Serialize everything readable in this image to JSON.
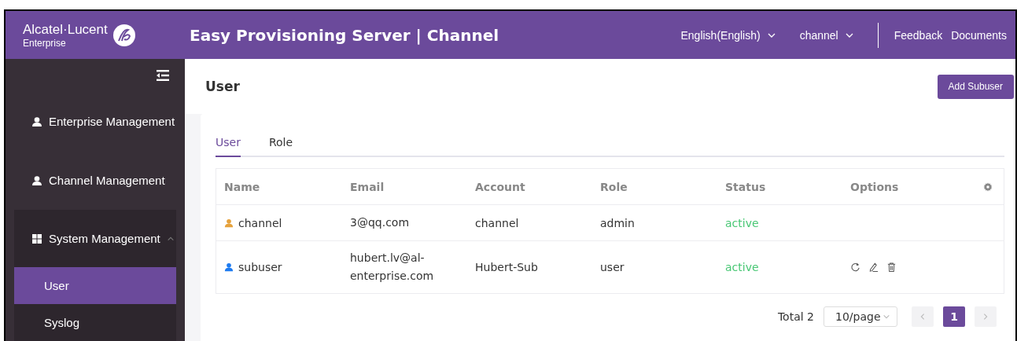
{
  "header": {
    "brand": "Alcatel·Lucent",
    "brand_sub": "Enterprise",
    "title": "Easy Provisioning Server | Channel",
    "language": "English(English)",
    "account": "channel",
    "links": [
      "Feedback",
      "Documents"
    ]
  },
  "sidebar": {
    "items": [
      {
        "label": "Enterprise Management",
        "kind": "person"
      },
      {
        "label": "Channel Management",
        "kind": "person"
      },
      {
        "label": "System Management",
        "kind": "group",
        "expanded": true,
        "children": [
          {
            "label": "User",
            "selected": true
          },
          {
            "label": "Syslog",
            "selected": false
          }
        ]
      }
    ]
  },
  "page": {
    "title": "User",
    "add_button": "Add Subuser"
  },
  "tabs": [
    {
      "label": "User",
      "selected": true
    },
    {
      "label": "Role",
      "selected": false
    }
  ],
  "table": {
    "columns": [
      "Name",
      "Email",
      "Account",
      "Role",
      "Status",
      "Options"
    ],
    "rows": [
      {
        "name": "channel",
        "color": "#e6a23c",
        "email": "3@qq.com",
        "account": "channel",
        "role": "admin",
        "status": "active",
        "options": []
      },
      {
        "name": "subuser",
        "color": "#1e7bf0",
        "email": "hubert.lv@al-enterprise.com",
        "account": "Hubert-Sub",
        "role": "user",
        "status": "active",
        "options": [
          {
            "kind": "reset"
          },
          {
            "kind": "edit"
          },
          {
            "kind": "delete"
          }
        ]
      }
    ]
  },
  "pagination": {
    "total": "Total 2",
    "page_size": "10/page",
    "pages": [
      {
        "label": "1",
        "selected": true
      }
    ]
  }
}
